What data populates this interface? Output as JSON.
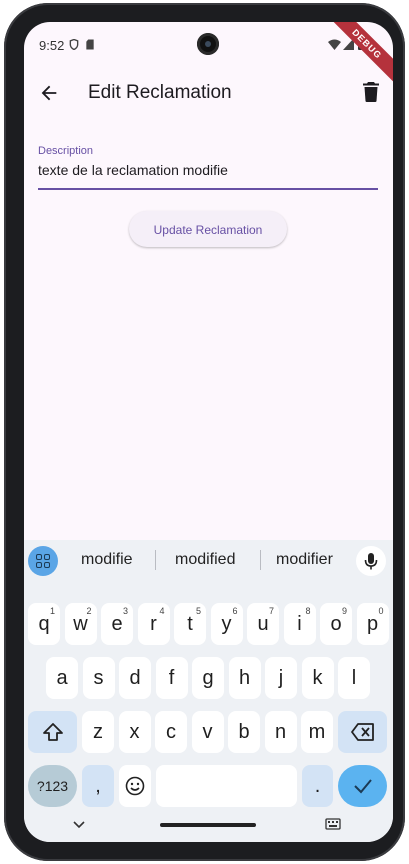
{
  "status_bar": {
    "time": "9:52",
    "debug_banner": "DEBUG"
  },
  "app_bar": {
    "title": "Edit Reclamation"
  },
  "form": {
    "description_label": "Description",
    "description_value": "texte de la reclamation modifie",
    "update_button": "Update Reclamation"
  },
  "keyboard": {
    "suggestions": [
      "modifie",
      "modified",
      "modifier"
    ],
    "row1": [
      {
        "k": "q",
        "n": "1"
      },
      {
        "k": "w",
        "n": "2"
      },
      {
        "k": "e",
        "n": "3"
      },
      {
        "k": "r",
        "n": "4"
      },
      {
        "k": "t",
        "n": "5"
      },
      {
        "k": "y",
        "n": "6"
      },
      {
        "k": "u",
        "n": "7"
      },
      {
        "k": "i",
        "n": "8"
      },
      {
        "k": "o",
        "n": "9"
      },
      {
        "k": "p",
        "n": "0"
      }
    ],
    "row2": [
      "a",
      "s",
      "d",
      "f",
      "g",
      "h",
      "j",
      "k",
      "l"
    ],
    "row3": [
      "z",
      "x",
      "c",
      "v",
      "b",
      "n",
      "m"
    ],
    "symbols_key": "?123",
    "comma_key": ",",
    "period_key": "."
  },
  "colors": {
    "accent": "#6750a4",
    "keyboard_accent": "#5bb3f0"
  },
  "icons": [
    "shield-icon",
    "sd-card-icon",
    "wifi-icon",
    "signal-icon",
    "battery-icon",
    "back-arrow-icon",
    "trash-icon",
    "apps-grid-icon",
    "mic-icon",
    "shift-icon",
    "backspace-icon",
    "emoji-icon",
    "enter-check-icon",
    "chevron-down-icon",
    "keyboard-switch-icon"
  ]
}
